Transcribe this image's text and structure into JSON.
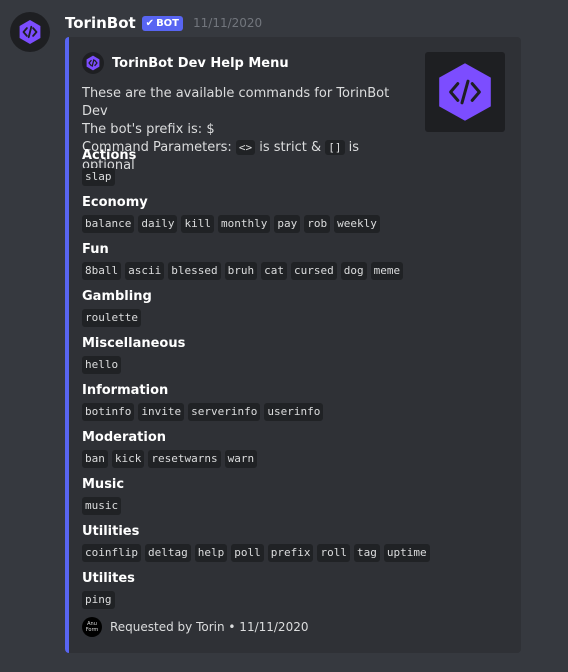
{
  "message": {
    "username": "TorinBot",
    "badge": "BOT",
    "timestamp": "11/11/2020"
  },
  "embed": {
    "author": "TorinBot Dev Help Menu",
    "description_line1": "These are the available commands for TorinBot Dev",
    "description_line2": "The bot's prefix is: $",
    "params_prefix": "Command Parameters: ",
    "params_strict_code": "<>",
    "params_strict_text": " is strict & ",
    "params_optional_code": "[]",
    "params_optional_text": " is optional",
    "fields": [
      {
        "name": "Actions",
        "commands": [
          "slap"
        ]
      },
      {
        "name": "Economy",
        "commands": [
          "balance",
          "daily",
          "kill",
          "monthly",
          "pay",
          "rob",
          "weekly"
        ]
      },
      {
        "name": "Fun",
        "commands": [
          "8ball",
          "ascii",
          "blessed",
          "bruh",
          "cat",
          "cursed",
          "dog",
          "meme"
        ]
      },
      {
        "name": "Gambling",
        "commands": [
          "roulette"
        ]
      },
      {
        "name": "Miscellaneous",
        "commands": [
          "hello"
        ]
      },
      {
        "name": "Information",
        "commands": [
          "botinfo",
          "invite",
          "serverinfo",
          "userinfo"
        ]
      },
      {
        "name": "Moderation",
        "commands": [
          "ban",
          "kick",
          "resetwarns",
          "warn"
        ]
      },
      {
        "name": "Music",
        "commands": [
          "music"
        ]
      },
      {
        "name": "Utilities",
        "commands": [
          "coinflip",
          "deltag",
          "help",
          "poll",
          "prefix",
          "roll",
          "tag",
          "uptime"
        ]
      },
      {
        "name": "Utilites",
        "commands": [
          "ping"
        ]
      }
    ],
    "footer_icon_text": [
      "Anu",
      "Form"
    ],
    "footer_text": "Requested by Torin • 11/11/2020",
    "accent_color": "#5865f2",
    "logo_color": "#7c4dff"
  }
}
